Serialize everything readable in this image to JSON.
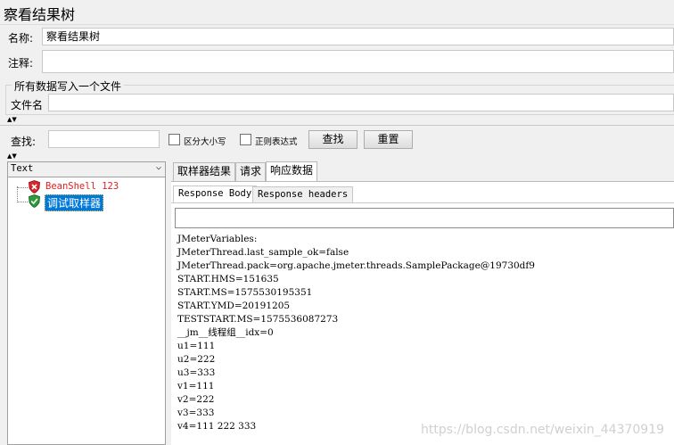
{
  "window": {
    "title": "察看结果树"
  },
  "form": {
    "name_label": "名称:",
    "name_value": "察看结果树",
    "comment_label": "注释:",
    "comment_value": "",
    "group_title": "所有数据写入一个文件",
    "file_label": "文件名",
    "file_value": ""
  },
  "search": {
    "label": "查找:",
    "value": "",
    "case_label": "区分大小写",
    "regex_label": "正则表达式",
    "find_button": "查找",
    "reset_button": "重置"
  },
  "tree": {
    "renderer": "Text",
    "items": [
      {
        "label": "BeanShell 123",
        "status": "error",
        "color": "#e02020"
      },
      {
        "label": "调试取样器",
        "status": "ok",
        "selected": true
      }
    ]
  },
  "tabs": [
    "取样器结果",
    "请求",
    "响应数据"
  ],
  "active_tab": "响应数据",
  "subtabs": [
    "Response Body",
    "Response headers"
  ],
  "response_search_value": "",
  "response_lines": [
    "JMeterVariables:",
    "JMeterThread.last_sample_ok=false",
    "JMeterThread.pack=org.apache.jmeter.threads.SamplePackage@19730df9",
    "START.HMS=151635",
    "START.MS=1575530195351",
    "START.YMD=20191205",
    "TESTSTART.MS=1575536087273",
    "__jm__线程组__idx=0",
    "u1=111",
    "u2=222",
    "u3=333",
    "v1=111",
    "v2=222",
    "v3=333",
    "v4=111 222 333"
  ],
  "watermark": "https://blog.csdn.net/weixin_44370919",
  "colors": {
    "selection": "#0078d7",
    "error_text": "#e02020",
    "error_icon": "#d9262d",
    "ok_icon": "#2e9b3a"
  }
}
